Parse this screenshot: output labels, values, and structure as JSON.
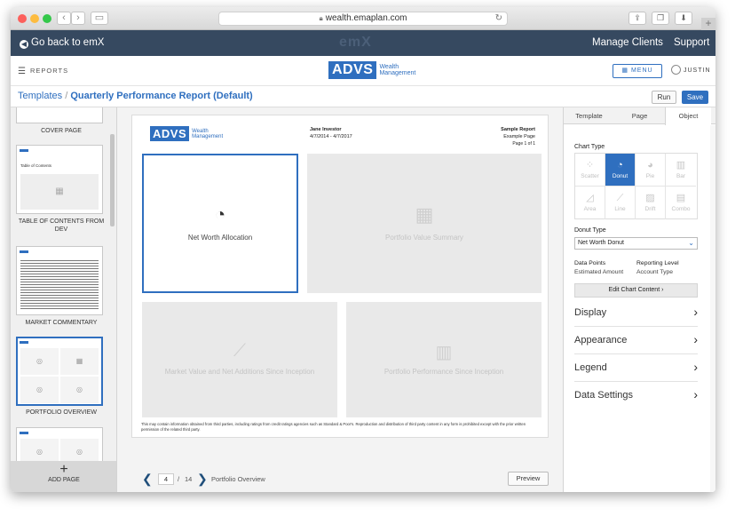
{
  "browser": {
    "url": "wealth.emaplan.com",
    "colors": {
      "close": "#fc605c",
      "minimize": "#fdbc40",
      "maximize": "#34c84a"
    }
  },
  "topbar": {
    "back_label": "Go back to emX",
    "brand": "emX",
    "nav": [
      "Manage Clients",
      "Support"
    ]
  },
  "header": {
    "reports_label": "REPORTS",
    "logo": {
      "box": "ADVS",
      "line1": "Wealth",
      "line2": "Management"
    },
    "menu_label": "MENU",
    "user_label": "JUSTIN"
  },
  "breadcrumb": {
    "root": "Templates",
    "separator": "/",
    "current": "Quarterly Performance Report (Default)"
  },
  "actions": {
    "run": "Run",
    "save": "Save"
  },
  "sidebar": {
    "pages": [
      {
        "label": "COVER PAGE"
      },
      {
        "label": "TABLE OF CONTENTS FROM DEV",
        "thumb_title": "Table of Contents"
      },
      {
        "label": "MARKET COMMENTARY"
      },
      {
        "label": "PORTFOLIO OVERVIEW"
      }
    ],
    "add_page": "ADD PAGE"
  },
  "page": {
    "client_name": "Jane Investor",
    "date_range": "4/7/2014 - 4/7/2017",
    "report_title": "Sample Report",
    "report_subtitle": "Example Page",
    "page_label": "Page 1 of 1",
    "tiles": [
      {
        "title": "Net Worth Allocation",
        "icon": "donut-icon"
      },
      {
        "title": "Portfolio Value Summary",
        "icon": "table-icon"
      },
      {
        "title": "Market Value and Net Additions Since Inception",
        "icon": "line-chart-icon"
      },
      {
        "title": "Portfolio Performance Since Inception",
        "icon": "bar-chart-icon"
      }
    ],
    "disclaimer": "This may contain information obtained from third parties, including ratings from credit ratings agencies such as Standard & Poor's. Reproduction and distribution of third party content in any form is prohibited except with the prior written permission of the related third party."
  },
  "pager": {
    "current": "4",
    "separator": "/",
    "total": "14",
    "page_name": "Portfolio Overview",
    "preview": "Preview"
  },
  "panel": {
    "tabs": [
      "Template",
      "Page",
      "Object"
    ],
    "active_tab": "Object",
    "chart_type_label": "Chart Type",
    "chart_types": [
      {
        "label": "Scatter",
        "icon": "scatter-icon"
      },
      {
        "label": "Donut",
        "icon": "donut-icon"
      },
      {
        "label": "Pie",
        "icon": "pie-icon"
      },
      {
        "label": "Bar",
        "icon": "bar-icon"
      },
      {
        "label": "Area",
        "icon": "area-icon"
      },
      {
        "label": "Line",
        "icon": "line-icon"
      },
      {
        "label": "Drift",
        "icon": "drift-icon"
      },
      {
        "label": "Combo",
        "icon": "combo-icon"
      }
    ],
    "selected_chart_type": "Donut",
    "donut_type_label": "Donut Type",
    "donut_type_value": "Net Worth Donut",
    "data_points_label": "Data Points",
    "data_points_value": "Estimated Amount",
    "reporting_level_label": "Reporting Level",
    "reporting_level_value": "Account Type",
    "edit_button": "Edit Chart Content",
    "sections": [
      "Display",
      "Appearance",
      "Legend",
      "Data Settings"
    ]
  },
  "accent_color": "#2f6fbf",
  "topbar_color": "#364960"
}
